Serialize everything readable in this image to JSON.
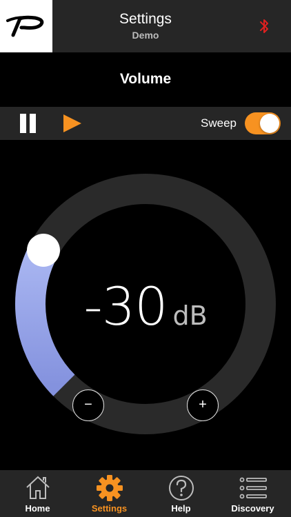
{
  "header": {
    "title": "Settings",
    "subtitle": "Demo",
    "logo_icon": "brand-p-logo",
    "bluetooth_icon": "bluetooth-icon",
    "bluetooth_color": "#e0201f"
  },
  "section": {
    "title": "Volume"
  },
  "controls": {
    "pause_icon": "pause-icon",
    "play_icon": "play-icon",
    "sweep_label": "Sweep",
    "sweep_on": true
  },
  "volume": {
    "value": "-30",
    "unit": "dB",
    "minus_label": "−",
    "plus_label": "+",
    "level_fraction": 0.27
  },
  "tabs": [
    {
      "label": "Home",
      "icon": "home-icon",
      "active": false
    },
    {
      "label": "Settings",
      "icon": "gear-icon",
      "active": true
    },
    {
      "label": "Help",
      "icon": "help-icon",
      "active": false
    },
    {
      "label": "Discovery",
      "icon": "list-icon",
      "active": false
    }
  ],
  "colors": {
    "accent": "#f79221",
    "panel": "#262626",
    "ring": "#2a2a2a",
    "arc_start": "#8f9be0",
    "arc_end": "#aab7f2"
  }
}
